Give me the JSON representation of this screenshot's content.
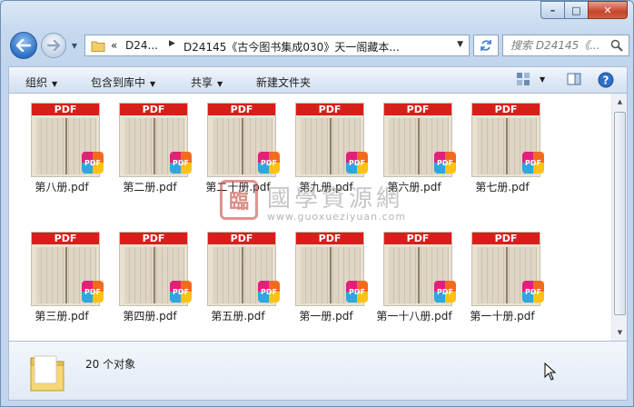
{
  "window": {
    "caption": {
      "minimize": "–",
      "maximize": "□",
      "close": "✕"
    }
  },
  "nav": {
    "history_arrow": "▼",
    "address": {
      "overflow": "«",
      "segments": [
        "D24...",
        "D24145《古今图书集成030》天一阁藏本..."
      ],
      "dropdown": "▼"
    },
    "search_placeholder": "搜索 D24145《..."
  },
  "toolbar": {
    "items": [
      {
        "label": "组织",
        "has_dropdown": true
      },
      {
        "label": "包含到库中",
        "has_dropdown": true
      },
      {
        "label": "共享",
        "has_dropdown": true
      },
      {
        "label": "新建文件夹",
        "has_dropdown": false
      }
    ],
    "dropdown_glyph": "▼",
    "right_icons": [
      "view-options-icon",
      "preview-pane-icon",
      "help-icon"
    ]
  },
  "files": {
    "badge_text": "PDF",
    "items": [
      {
        "name": "第八册.pdf"
      },
      {
        "name": "第二册.pdf"
      },
      {
        "name": "第二十册.pdf"
      },
      {
        "name": "第九册.pdf"
      },
      {
        "name": "第六册.pdf"
      },
      {
        "name": "第七册.pdf"
      },
      {
        "name": "第三册.pdf"
      },
      {
        "name": "第四册.pdf"
      },
      {
        "name": "第五册.pdf"
      },
      {
        "name": "第一册.pdf"
      },
      {
        "name": "第一十八册.pdf"
      },
      {
        "name": "第一十册.pdf"
      }
    ]
  },
  "watermark": {
    "seal": "臨",
    "title": "國學資源網",
    "url": "www.guoxueziyuan.com"
  },
  "details": {
    "count": "20 个对象"
  },
  "colors": {
    "pdf_band": "#d71f1a",
    "window_chrome": "#c6d9ee",
    "close_button": "#c5452b"
  }
}
